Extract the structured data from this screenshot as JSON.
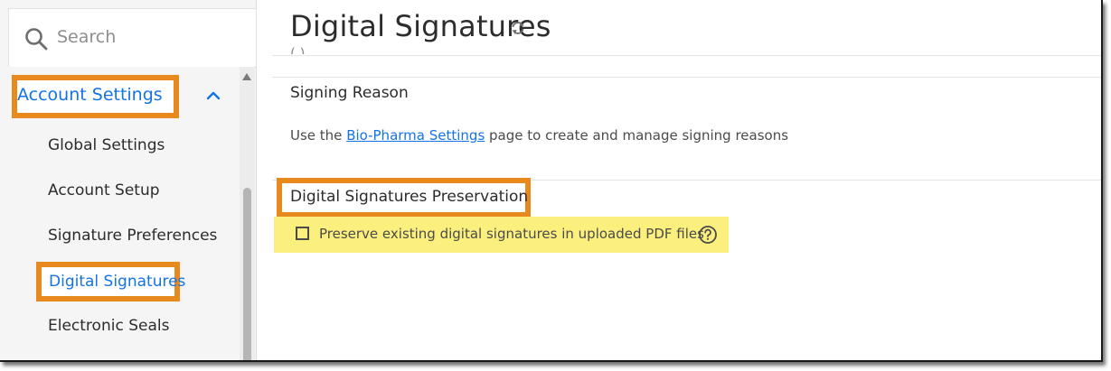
{
  "search": {
    "placeholder": "Search"
  },
  "sidebar": {
    "section_label": "Account Settings",
    "items": [
      {
        "label": "Global Settings"
      },
      {
        "label": "Account Setup"
      },
      {
        "label": "Signature Preferences"
      },
      {
        "label": "Digital Signatures",
        "active": true
      },
      {
        "label": "Electronic Seals"
      }
    ]
  },
  "page": {
    "title": "Digital Signatures",
    "cut_off_text": "( )"
  },
  "signing_reason": {
    "title": "Signing Reason",
    "desc_prefix": "Use the ",
    "link_text": "Bio-Pharma Settings",
    "desc_suffix": " page to create and manage signing reasons"
  },
  "preservation": {
    "title": "Digital Signatures Preservation",
    "checkbox_label": "Preserve existing digital signatures in uploaded PDF files",
    "checked": false
  },
  "colors": {
    "accent": "#1473e6",
    "highlight_orange": "#e8891e",
    "highlight_yellow": "#fbef7e"
  },
  "icons": [
    "search-icon",
    "chevron-up-icon",
    "refresh-icon",
    "help-icon",
    "scroll-up-arrow-icon"
  ]
}
